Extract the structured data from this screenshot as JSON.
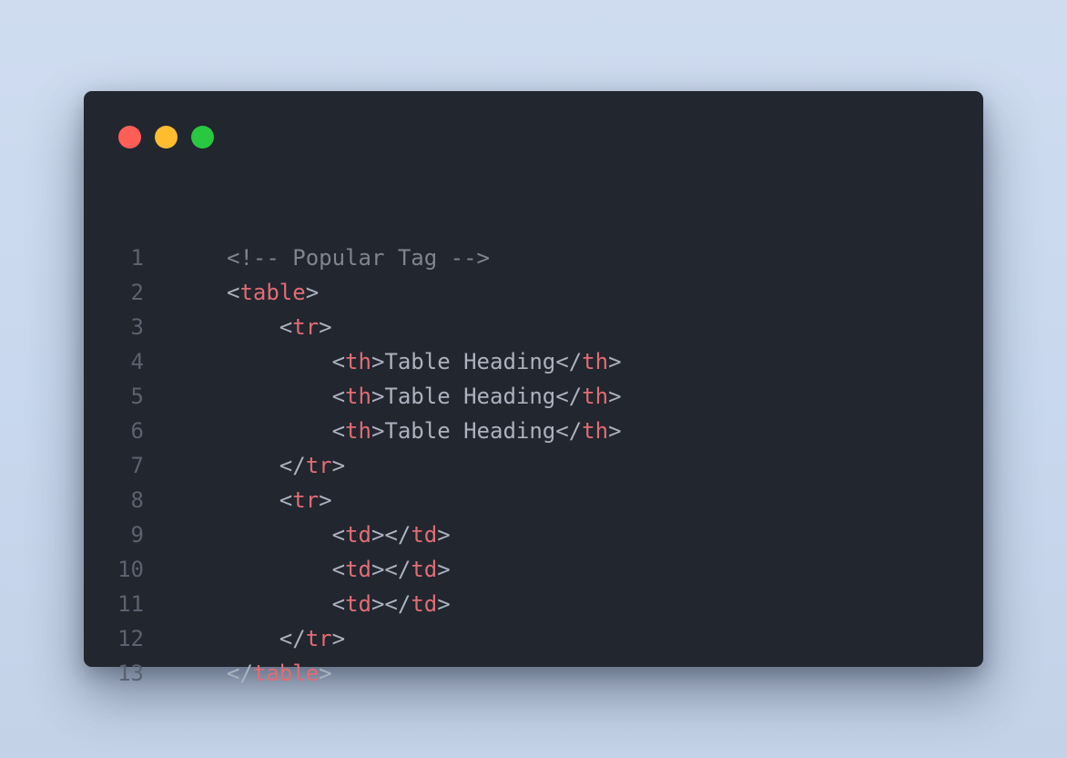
{
  "window": {
    "controls": [
      {
        "name": "close",
        "color": "#ff5f57"
      },
      {
        "name": "minimize",
        "color": "#febc2e"
      },
      {
        "name": "maximize",
        "color": "#28c840"
      }
    ]
  },
  "code": {
    "lines": [
      {
        "number": "1",
        "indent": "",
        "tokens": [
          {
            "t": "comment",
            "v": "<!-- Popular Tag -->"
          }
        ]
      },
      {
        "number": "2",
        "indent": "",
        "tokens": [
          {
            "t": "punct",
            "v": "<"
          },
          {
            "t": "tag",
            "v": "table"
          },
          {
            "t": "punct",
            "v": ">"
          }
        ]
      },
      {
        "number": "3",
        "indent": "    ",
        "tokens": [
          {
            "t": "punct",
            "v": "<"
          },
          {
            "t": "tag",
            "v": "tr"
          },
          {
            "t": "punct",
            "v": ">"
          }
        ]
      },
      {
        "number": "4",
        "indent": "        ",
        "tokens": [
          {
            "t": "punct",
            "v": "<"
          },
          {
            "t": "tag",
            "v": "th"
          },
          {
            "t": "punct",
            "v": ">"
          },
          {
            "t": "text",
            "v": "Table Heading"
          },
          {
            "t": "punct",
            "v": "</"
          },
          {
            "t": "tag",
            "v": "th"
          },
          {
            "t": "punct",
            "v": ">"
          }
        ]
      },
      {
        "number": "5",
        "indent": "        ",
        "tokens": [
          {
            "t": "punct",
            "v": "<"
          },
          {
            "t": "tag",
            "v": "th"
          },
          {
            "t": "punct",
            "v": ">"
          },
          {
            "t": "text",
            "v": "Table Heading"
          },
          {
            "t": "punct",
            "v": "</"
          },
          {
            "t": "tag",
            "v": "th"
          },
          {
            "t": "punct",
            "v": ">"
          }
        ]
      },
      {
        "number": "6",
        "indent": "        ",
        "tokens": [
          {
            "t": "punct",
            "v": "<"
          },
          {
            "t": "tag",
            "v": "th"
          },
          {
            "t": "punct",
            "v": ">"
          },
          {
            "t": "text",
            "v": "Table Heading"
          },
          {
            "t": "punct",
            "v": "</"
          },
          {
            "t": "tag",
            "v": "th"
          },
          {
            "t": "punct",
            "v": ">"
          }
        ]
      },
      {
        "number": "7",
        "indent": "    ",
        "tokens": [
          {
            "t": "punct",
            "v": "</"
          },
          {
            "t": "tag",
            "v": "tr"
          },
          {
            "t": "punct",
            "v": ">"
          }
        ]
      },
      {
        "number": "8",
        "indent": "    ",
        "tokens": [
          {
            "t": "punct",
            "v": "<"
          },
          {
            "t": "tag",
            "v": "tr"
          },
          {
            "t": "punct",
            "v": ">"
          }
        ]
      },
      {
        "number": "9",
        "indent": "        ",
        "tokens": [
          {
            "t": "punct",
            "v": "<"
          },
          {
            "t": "tag",
            "v": "td"
          },
          {
            "t": "punct",
            "v": "></"
          },
          {
            "t": "tag",
            "v": "td"
          },
          {
            "t": "punct",
            "v": ">"
          }
        ]
      },
      {
        "number": "10",
        "indent": "        ",
        "tokens": [
          {
            "t": "punct",
            "v": "<"
          },
          {
            "t": "tag",
            "v": "td"
          },
          {
            "t": "punct",
            "v": "></"
          },
          {
            "t": "tag",
            "v": "td"
          },
          {
            "t": "punct",
            "v": ">"
          }
        ]
      },
      {
        "number": "11",
        "indent": "        ",
        "tokens": [
          {
            "t": "punct",
            "v": "<"
          },
          {
            "t": "tag",
            "v": "td"
          },
          {
            "t": "punct",
            "v": "></"
          },
          {
            "t": "tag",
            "v": "td"
          },
          {
            "t": "punct",
            "v": ">"
          }
        ]
      },
      {
        "number": "12",
        "indent": "    ",
        "tokens": [
          {
            "t": "punct",
            "v": "</"
          },
          {
            "t": "tag",
            "v": "tr"
          },
          {
            "t": "punct",
            "v": ">"
          }
        ]
      },
      {
        "number": "13",
        "indent": "",
        "tokens": [
          {
            "t": "punct",
            "v": "</"
          },
          {
            "t": "tag",
            "v": "table"
          },
          {
            "t": "punct",
            "v": ">"
          }
        ]
      }
    ]
  },
  "colors": {
    "background": "#22262e",
    "line_number": "#5b6270",
    "comment": "#7f848e",
    "punct": "#abb2bf",
    "tag": "#e06c75",
    "text": "#abb2bf"
  }
}
